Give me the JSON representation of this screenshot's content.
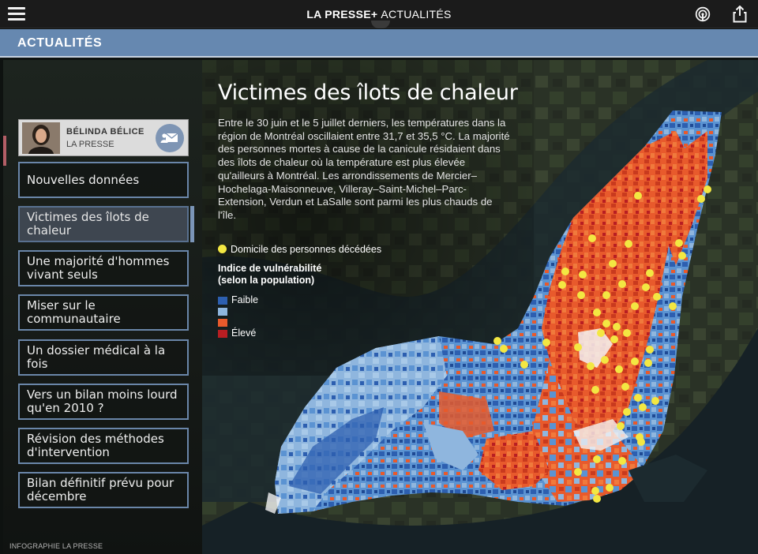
{
  "topbar": {
    "brand": "LA PRESSE+",
    "section": "ACTUALITÉS"
  },
  "section_band": {
    "label": "ACTUALITÉS"
  },
  "author": {
    "name": "BÉLINDA BÉLICE",
    "org": "LA PRESSE"
  },
  "nav": [
    {
      "label": "Nouvelles données",
      "active": false
    },
    {
      "label": "Victimes des îlots de chaleur",
      "active": true
    },
    {
      "label": "Une majorité d'hommes vivant seuls",
      "active": false
    },
    {
      "label": "Miser sur le communautaire",
      "active": false
    },
    {
      "label": "Un dossier médical à la fois",
      "active": false
    },
    {
      "label": "Vers un bilan moins lourd qu'en 2010 ?",
      "active": false
    },
    {
      "label": "Révision des méthodes d'intervention",
      "active": false
    },
    {
      "label": "Bilan définitif prévu pour décembre",
      "active": false
    }
  ],
  "article": {
    "title": "Victimes des îlots de chaleur",
    "body": "Entre le 30 juin et le 5 juillet derniers, les températures dans la région de Montréal oscillaient entre 31,7 et 35,5 °C. La majorité des personnes mortes à cause de la canicule résidaient dans des îlots de chaleur où la température est plus élevée qu'ailleurs à Montréal. Les arrondissements de Mercier–Hochelaga-Maisonneuve, Villeray–Saint-Michel–Parc-Extension, Verdun et LaSalle sont parmi les plus chauds de l'île."
  },
  "legend": {
    "dot_label": "Domicile des personnes décédées",
    "title_line1": "Indice de vulnérabilité",
    "title_line2": "(selon la population)",
    "low_label": "Faible",
    "high_label": "Élevé",
    "colors": [
      "#2d5fb0",
      "#8fb6de",
      "#e85a2c",
      "#b81e22"
    ]
  },
  "credit": "INFOGRAPHIE LA PRESSE",
  "icons": [
    "menu-icon",
    "podcast-icon",
    "share-icon",
    "mail-icon"
  ]
}
